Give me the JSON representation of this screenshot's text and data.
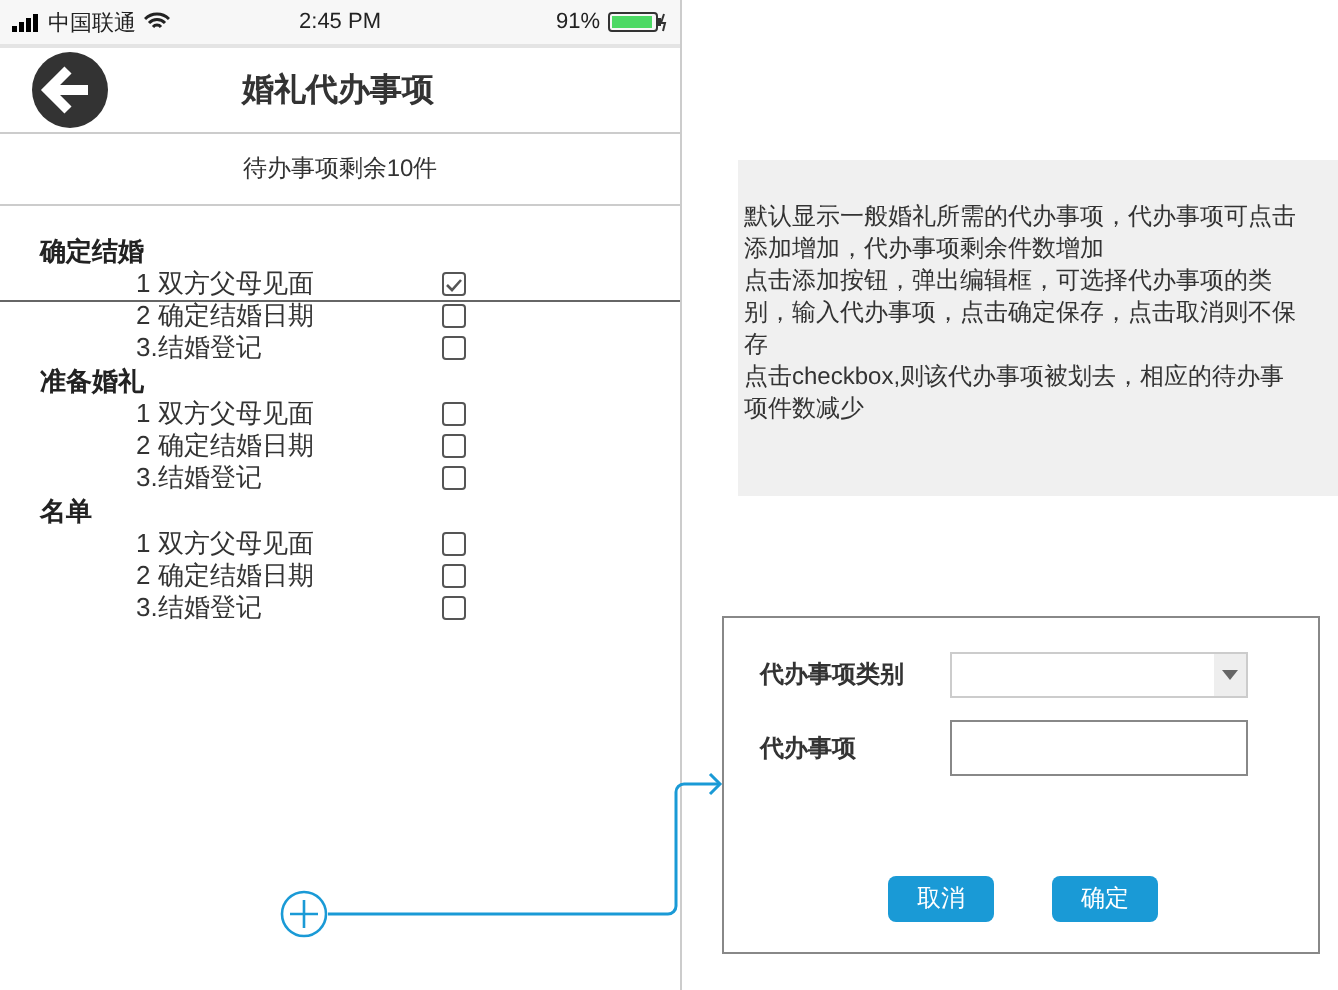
{
  "status_bar": {
    "carrier": "中国联通",
    "time": "2:45 PM",
    "battery": "91%"
  },
  "header": {
    "title": "婚礼代办事项"
  },
  "summary": "待办事项剩余10件",
  "groups": [
    {
      "title": "确定结婚",
      "items": [
        {
          "label": "1 双方父母见面",
          "checked": true
        },
        {
          "label": "2 确定结婚日期",
          "checked": false
        },
        {
          "label": "3.结婚登记",
          "checked": false
        }
      ]
    },
    {
      "title": "准备婚礼",
      "items": [
        {
          "label": "1 双方父母见面",
          "checked": false
        },
        {
          "label": "2 确定结婚日期",
          "checked": false
        },
        {
          "label": "3.结婚登记",
          "checked": false
        }
      ]
    },
    {
      "title": "名单",
      "items": [
        {
          "label": "1 双方父母见面",
          "checked": false
        },
        {
          "label": "2 确定结婚日期",
          "checked": false
        },
        {
          "label": "3.结婚登记",
          "checked": false
        }
      ]
    }
  ],
  "note": [
    "默认显示一般婚礼所需的代办事项，代办事项可点击添加增加，代办事项剩余件数增加",
    "点击添加按钮，弹出编辑框，可选择代办事项的类别，输入代办事项，点击确定保存，点击取消则不保存",
    "点击checkbox,则该代办事项被划去，相应的待办事项件数减少"
  ],
  "dialog": {
    "category_label": "代办事项类别",
    "item_label": "代办事项",
    "buttons": [
      "取消",
      "确定"
    ]
  }
}
